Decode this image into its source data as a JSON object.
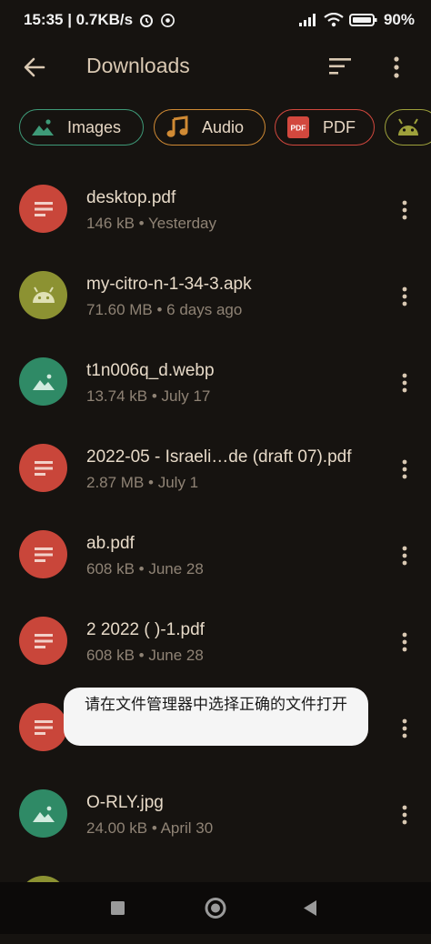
{
  "status_bar": {
    "time_speed": "15:35 | 0.7KB/s",
    "battery_percent": "90%"
  },
  "app_bar": {
    "title": "Downloads",
    "icons": [
      "back-arrow-icon",
      "sort-icon",
      "more-vert-icon"
    ]
  },
  "filters": [
    {
      "label": "Images",
      "icon": "image-icon",
      "color": "#3e9a78"
    },
    {
      "label": "Audio",
      "icon": "music-note-icon",
      "color": "#d08a34"
    },
    {
      "label": "PDF",
      "icon": "pdf-icon",
      "color": "#d2483e"
    },
    {
      "label": "",
      "icon": "android-icon",
      "color": "#9ea13b"
    }
  ],
  "files": [
    {
      "name": "desktop.pdf",
      "meta": "146 kB • Yesterday",
      "type": "pdf"
    },
    {
      "name": "my-citro-n-1-34-3.apk",
      "meta": "71.60 MB • 6 days ago",
      "type": "apk"
    },
    {
      "name": "t1n006q_d.webp",
      "meta": "13.74 kB • July 17",
      "type": "image"
    },
    {
      "name": "2022-05 - Israeli…de (draft 07).pdf",
      "meta": "2.87 MB • July 1",
      "type": "pdf"
    },
    {
      "name": "ab.pdf",
      "meta": "608 kB • June 28",
      "type": "pdf"
    },
    {
      "name": "2       2022 (     )-1.pdf",
      "meta": "608 kB • June 28",
      "type": "pdf"
    },
    {
      "name": "",
      "meta": "",
      "type": "pdf"
    },
    {
      "name": "O-RLY.jpg",
      "meta": "24.00 kB • April 30",
      "type": "image"
    },
    {
      "name": "",
      "meta": "",
      "type": "apk"
    }
  ],
  "toast": {
    "text": "请在文件管理器中选择正确的文件打开"
  },
  "type_colors": {
    "pdf": "#c9463a",
    "apk": "#8c9232",
    "image": "#2f8a66"
  }
}
